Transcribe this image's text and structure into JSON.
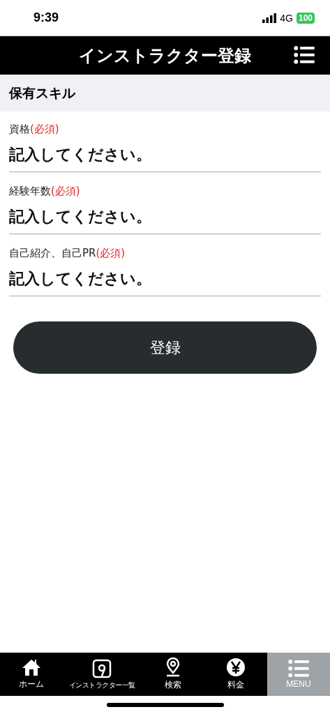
{
  "status_bar": {
    "time": "9:39",
    "network": "4G",
    "battery": "100"
  },
  "header": {
    "title": "インストラクター登録"
  },
  "section": {
    "title": "保有スキル"
  },
  "fields": [
    {
      "label": "資格",
      "required": "(必須)",
      "placeholder": "記入してください。"
    },
    {
      "label": "経験年数",
      "required": "(必須)",
      "placeholder": "記入してください。"
    },
    {
      "label": "自己紹介、自己PR",
      "required": "(必須)",
      "placeholder": "記入してください。"
    }
  ],
  "submit": "登録",
  "tab_bar": [
    {
      "kind": "home",
      "label": "ホーム",
      "selected": false
    },
    {
      "kind": "instructors",
      "label": "インストラクター一覧",
      "selected": false
    },
    {
      "kind": "search",
      "label": "検索",
      "selected": false
    },
    {
      "kind": "price",
      "label": "料金",
      "selected": false
    },
    {
      "kind": "menu",
      "label": "MENU",
      "selected": true
    }
  ]
}
